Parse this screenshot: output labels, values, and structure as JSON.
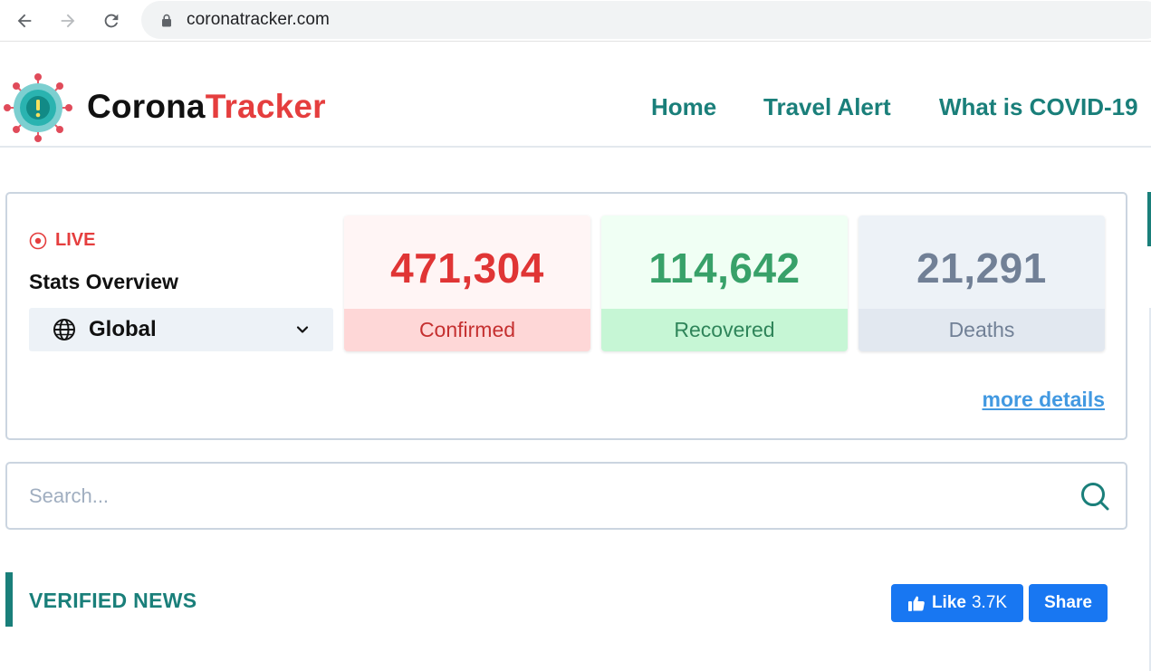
{
  "browser": {
    "url": "coronatracker.com",
    "icons": {
      "back": "arrow-left-icon",
      "forward": "arrow-right-icon",
      "reload": "reload-icon",
      "secure": "lock-icon"
    }
  },
  "header": {
    "brand_part1": "Corona",
    "brand_part2": "Tracker",
    "nav": [
      "Home",
      "Travel Alert",
      "What is COVID-19"
    ]
  },
  "stats": {
    "live_label": "LIVE",
    "title": "Stats Overview",
    "region": "Global",
    "confirmed": {
      "value": "471,304",
      "label": "Confirmed"
    },
    "recovered": {
      "value": "114,642",
      "label": "Recovered"
    },
    "deaths": {
      "value": "21,291",
      "label": "Deaths"
    },
    "more_details": "more details"
  },
  "search": {
    "placeholder": "Search..."
  },
  "news": {
    "title": "VERIFIED NEWS",
    "like_label": "Like",
    "like_count": "3.7K",
    "share_label": "Share"
  },
  "colors": {
    "brand_teal": "#1a7f7a",
    "brand_red": "#e53e3e",
    "confirmed": "#e03535",
    "recovered": "#38a169",
    "deaths": "#718096",
    "link_blue": "#4299e1",
    "facebook_blue": "#1877f2"
  }
}
